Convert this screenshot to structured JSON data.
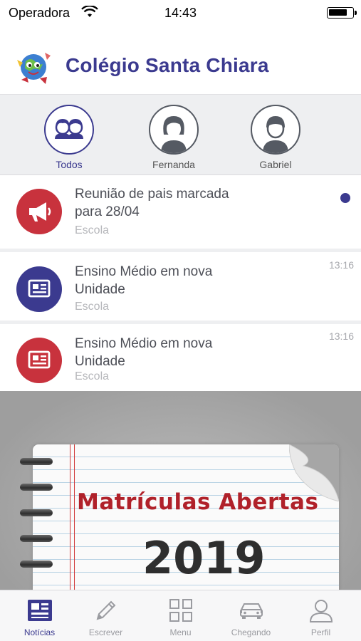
{
  "status_bar": {
    "carrier": "Operadora",
    "time": "14:43"
  },
  "header": {
    "title": "Colégio Santa Chiara"
  },
  "profiles": [
    {
      "label": "Todos",
      "active": true
    },
    {
      "label": "Fernanda",
      "active": false
    },
    {
      "label": "Gabriel",
      "active": false
    }
  ],
  "news": [
    {
      "headline_line1": "Reunião de pais marcada",
      "headline_line2": "para 28/04",
      "category": "Escola",
      "time": "",
      "unread": true,
      "icon": "megaphone-icon",
      "icon_color": "#c8323d"
    },
    {
      "headline_line1": "Ensino Médio em nova",
      "headline_line2": "Unidade",
      "category": "Escola",
      "time": "13:16",
      "unread": false,
      "icon": "newspaper-icon",
      "icon_color": "#3b3a8f"
    },
    {
      "headline_line1": "Ensino Médio em nova",
      "headline_line2": "Unidade",
      "category": "Escola",
      "time": "13:16",
      "unread": false,
      "icon": "newspaper-icon",
      "icon_color": "#c8323d"
    }
  ],
  "banner": {
    "headline": "Matrículas Abertas",
    "year": "2019"
  },
  "tabs": [
    {
      "label": "Notícias",
      "icon": "newspaper-icon",
      "active": true
    },
    {
      "label": "Escrever",
      "icon": "pencil-icon",
      "active": false
    },
    {
      "label": "Menu",
      "icon": "grid-icon",
      "active": false
    },
    {
      "label": "Chegando",
      "icon": "car-icon",
      "active": false
    },
    {
      "label": "Perfil",
      "icon": "person-icon",
      "active": false
    }
  ],
  "colors": {
    "brand": "#3b3a8f",
    "accent_red": "#c8323d",
    "unread_dot": "#3b3a8f"
  }
}
